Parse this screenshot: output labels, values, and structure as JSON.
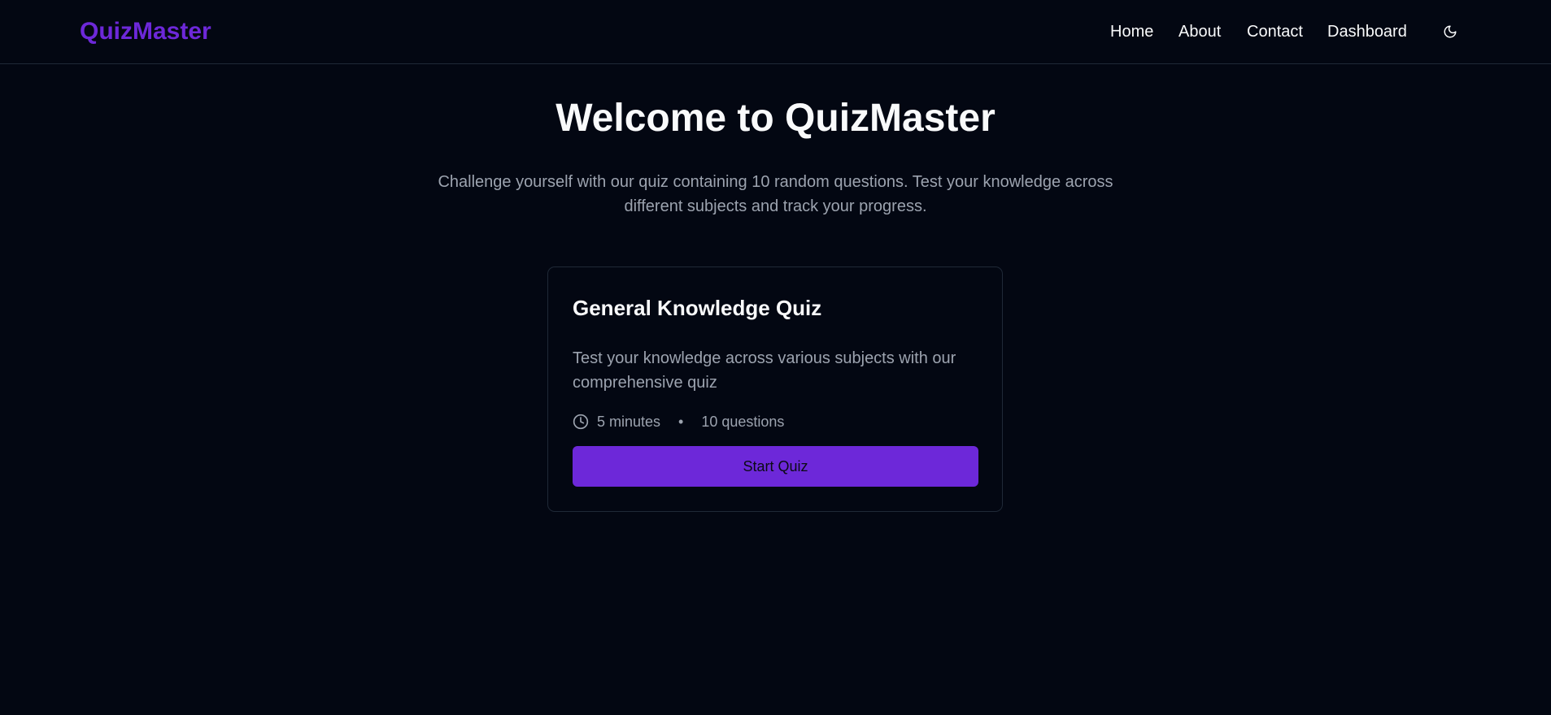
{
  "header": {
    "brand": "QuizMaster",
    "nav": {
      "home": "Home",
      "about": "About",
      "contact": "Contact",
      "dashboard": "Dashboard"
    },
    "theme_toggle_icon": "moon-icon"
  },
  "hero": {
    "title": "Welcome to QuizMaster",
    "subtitle": "Challenge yourself with our quiz containing 10 random questions. Test your knowledge across different subjects and track your progress."
  },
  "quiz_card": {
    "title": "General Knowledge Quiz",
    "description": "Test your knowledge across various subjects with our comprehensive quiz",
    "duration": "5 minutes",
    "separator": "•",
    "questions": "10 questions",
    "duration_icon": "clock-icon",
    "start_label": "Start Quiz"
  },
  "colors": {
    "background": "#030712",
    "accent": "#6d28d9",
    "text": "#f9fafb",
    "muted_text": "#9ca3af",
    "border": "#1f2937"
  }
}
